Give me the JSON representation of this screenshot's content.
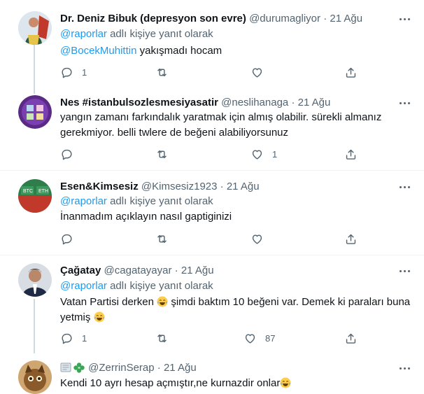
{
  "tweets": [
    {
      "name": "Dr. Deniz Bibuk (depresyon son evre)",
      "handle": "@durumagliyor",
      "time": "21 Ağu",
      "reply_to_mention": "@raporlar",
      "reply_to_suffix": "adlı kişiye yanıt olarak",
      "text_mention": "@BocekMuhittin",
      "text": "yakışmadı hocam",
      "reply_count": "1",
      "retweet_count": "",
      "like_count": ""
    },
    {
      "name": "Nes #istanbulsozlesmesiyasatir",
      "handle": "@neslihanaga",
      "time": "21 Ağu",
      "text_line1": "yangın zamanı farkındalık yaratmak için almış olabilir. sürekli almanız",
      "text_line2": "gerekmiyor. belli twlere de beğeni alabiliyorsunuz",
      "reply_count": "",
      "retweet_count": "",
      "like_count": "1"
    },
    {
      "name": "Esen&Kimsesiz",
      "handle": "@Kimsesiz1923",
      "time": "21 Ağu",
      "reply_to_mention": "@raporlar",
      "reply_to_suffix": "adlı kişiye yanıt olarak",
      "text": "İnanmadım açıklayın nasıl gaptiginizi",
      "avatar_labels": [
        "BTC",
        "ETH"
      ],
      "reply_count": "",
      "retweet_count": "",
      "like_count": ""
    },
    {
      "name": "Çağatay",
      "handle": "@cagatayayar",
      "time": "21 Ağu",
      "reply_to_mention": "@raporlar",
      "reply_to_suffix": "adlı kişiye yanıt olarak",
      "text_line1_a": "Vatan Partisi derken",
      "text_line1_b": "şimdi baktım 10 beğeni var. Demek ki paraları buna",
      "text_line2": "yetmiş",
      "reply_count": "1",
      "retweet_count": "",
      "like_count": "87"
    },
    {
      "name": "",
      "handle": "@ZerrinSerap",
      "time": "21 Ağu",
      "text": "Kendi 10 ayrı hesap açmıştır,ne kurnazdir onlar"
    }
  ],
  "dot": "·",
  "colors": {
    "accent": "#1d9bf0",
    "muted": "#536471",
    "text": "#0f1419",
    "line": "#cfd9de"
  }
}
